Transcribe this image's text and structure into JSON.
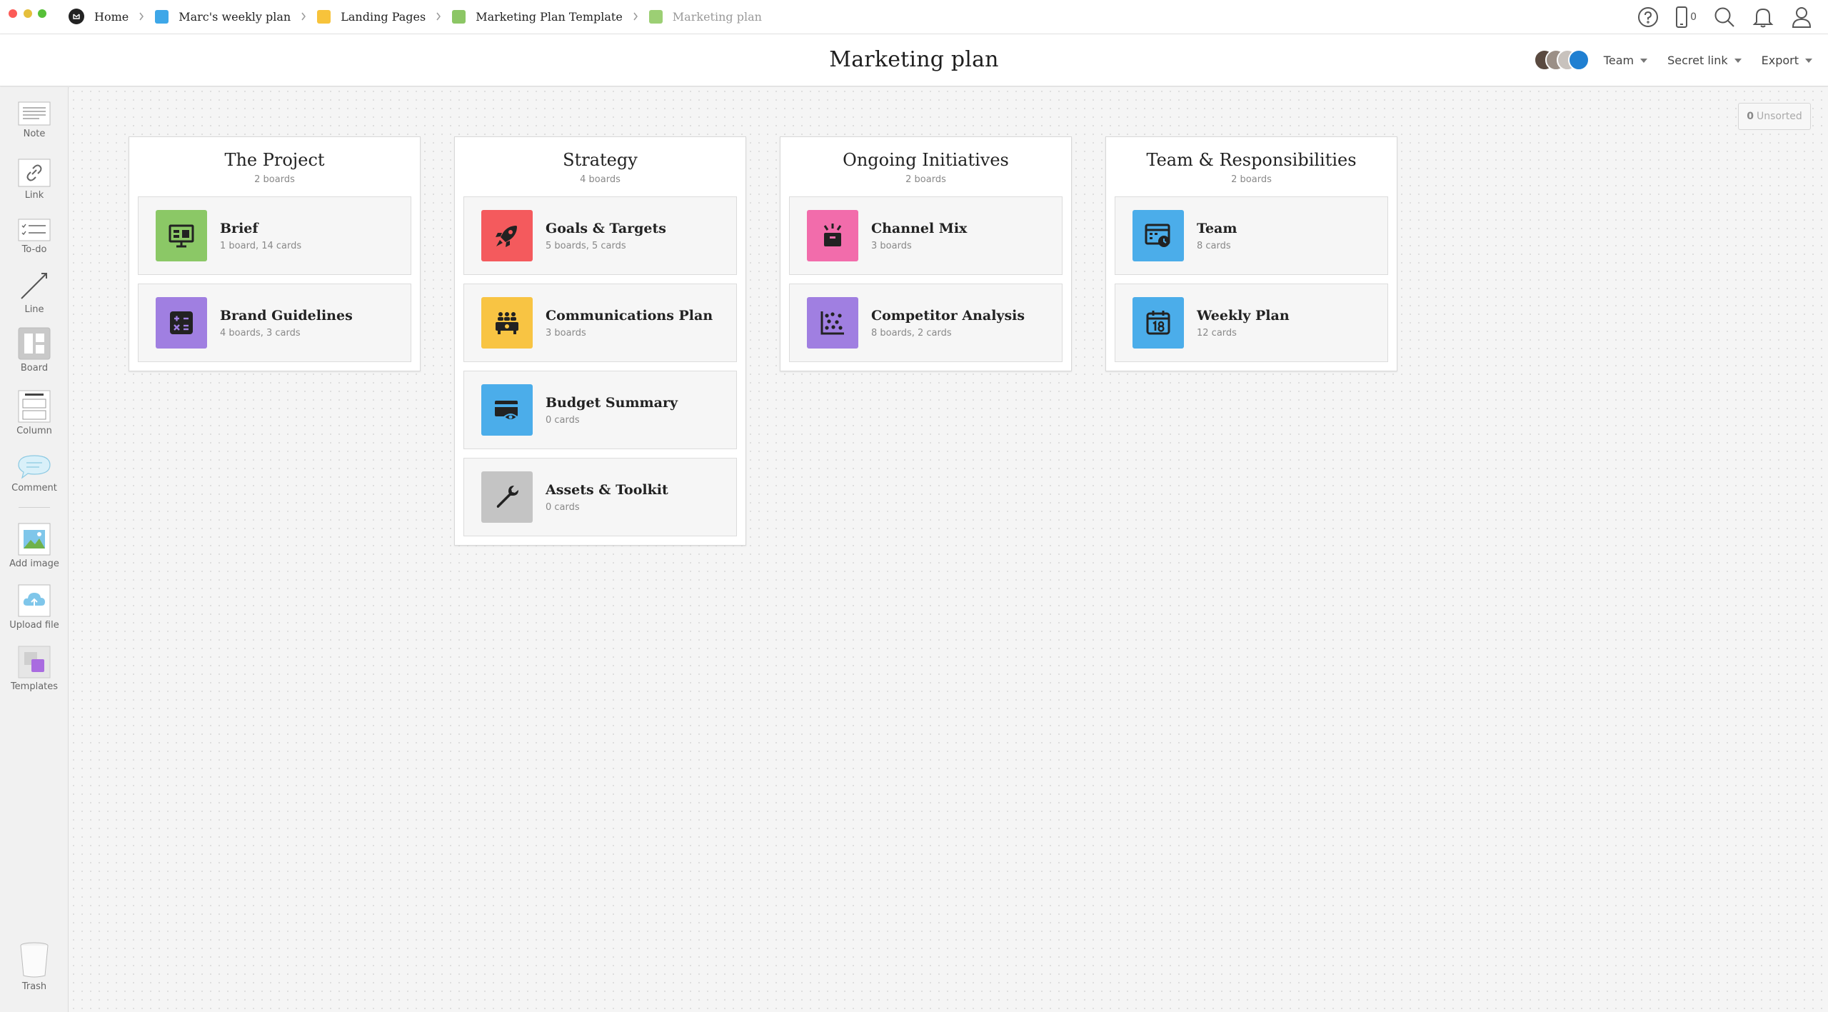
{
  "breadcrumb": [
    {
      "label": "Home",
      "color": "#222222",
      "icon": "home-logo"
    },
    {
      "label": "Marc's weekly plan",
      "color": "#3ea7e8"
    },
    {
      "label": "Landing Pages",
      "color": "#f7c33b"
    },
    {
      "label": "Marketing Plan Template",
      "color": "#8cc665"
    },
    {
      "label": "Marketing plan",
      "color": "#9ccf74",
      "current": true
    }
  ],
  "top_icons": {
    "help": "help-icon",
    "device": "phone-icon",
    "device_count": "0",
    "search": "search-icon",
    "notifications": "bell-icon",
    "account": "user-icon"
  },
  "header": {
    "title": "Marketing plan",
    "team_label": "Team",
    "secret_link_label": "Secret link",
    "export_label": "Export"
  },
  "toolbar": {
    "items": [
      {
        "label": "Note",
        "icon": "note-icon"
      },
      {
        "label": "Link",
        "icon": "link-icon"
      },
      {
        "label": "To-do",
        "icon": "todo-icon"
      },
      {
        "label": "Line",
        "icon": "line-icon"
      },
      {
        "label": "Board",
        "icon": "board-icon"
      },
      {
        "label": "Column",
        "icon": "column-icon"
      },
      {
        "label": "Comment",
        "icon": "comment-icon"
      },
      {
        "label": "Add image",
        "icon": "image-icon"
      },
      {
        "label": "Upload file",
        "icon": "upload-icon"
      },
      {
        "label": "Templates",
        "icon": "templates-icon"
      },
      {
        "label": "Trash",
        "icon": "trash-icon"
      }
    ]
  },
  "unsorted": {
    "count": "0",
    "label": "Unsorted"
  },
  "columns": [
    {
      "title": "The Project",
      "subtitle": "2 boards",
      "boards": [
        {
          "name": "Brief",
          "meta": "1 board, 14 cards",
          "color": "#8bc866",
          "icon": "presentation-icon"
        },
        {
          "name": "Brand Guidelines",
          "meta": "4 boards, 3 cards",
          "color": "#a07fe1",
          "icon": "calculator-icon"
        }
      ]
    },
    {
      "title": "Strategy",
      "subtitle": "4 boards",
      "boards": [
        {
          "name": "Goals & Targets",
          "meta": "5 boards, 5 cards",
          "color": "#f45a5d",
          "icon": "rocket-icon"
        },
        {
          "name": "Communications Plan",
          "meta": "3 boards",
          "color": "#f8c443",
          "icon": "audience-icon"
        },
        {
          "name": "Budget Summary",
          "meta": "0 cards",
          "color": "#4badea",
          "icon": "credit-card-icon"
        },
        {
          "name": "Assets & Toolkit",
          "meta": "0 cards",
          "color": "#c4c4c4",
          "icon": "wrench-icon"
        }
      ]
    },
    {
      "title": "Ongoing Initiatives",
      "subtitle": "2 boards",
      "boards": [
        {
          "name": "Channel Mix",
          "meta": "3 boards",
          "color": "#f26cab",
          "icon": "box-burst-icon"
        },
        {
          "name": "Competitor Analysis",
          "meta": "8 boards, 2 cards",
          "color": "#a07fe1",
          "icon": "scatter-chart-icon"
        }
      ]
    },
    {
      "title": "Team & Responsibilities",
      "subtitle": "2 boards",
      "boards": [
        {
          "name": "Team",
          "meta": "8 cards",
          "color": "#4badea",
          "icon": "schedule-icon"
        },
        {
          "name": "Weekly Plan",
          "meta": "12 cards",
          "color": "#4badea",
          "icon": "calendar-icon"
        }
      ]
    }
  ]
}
